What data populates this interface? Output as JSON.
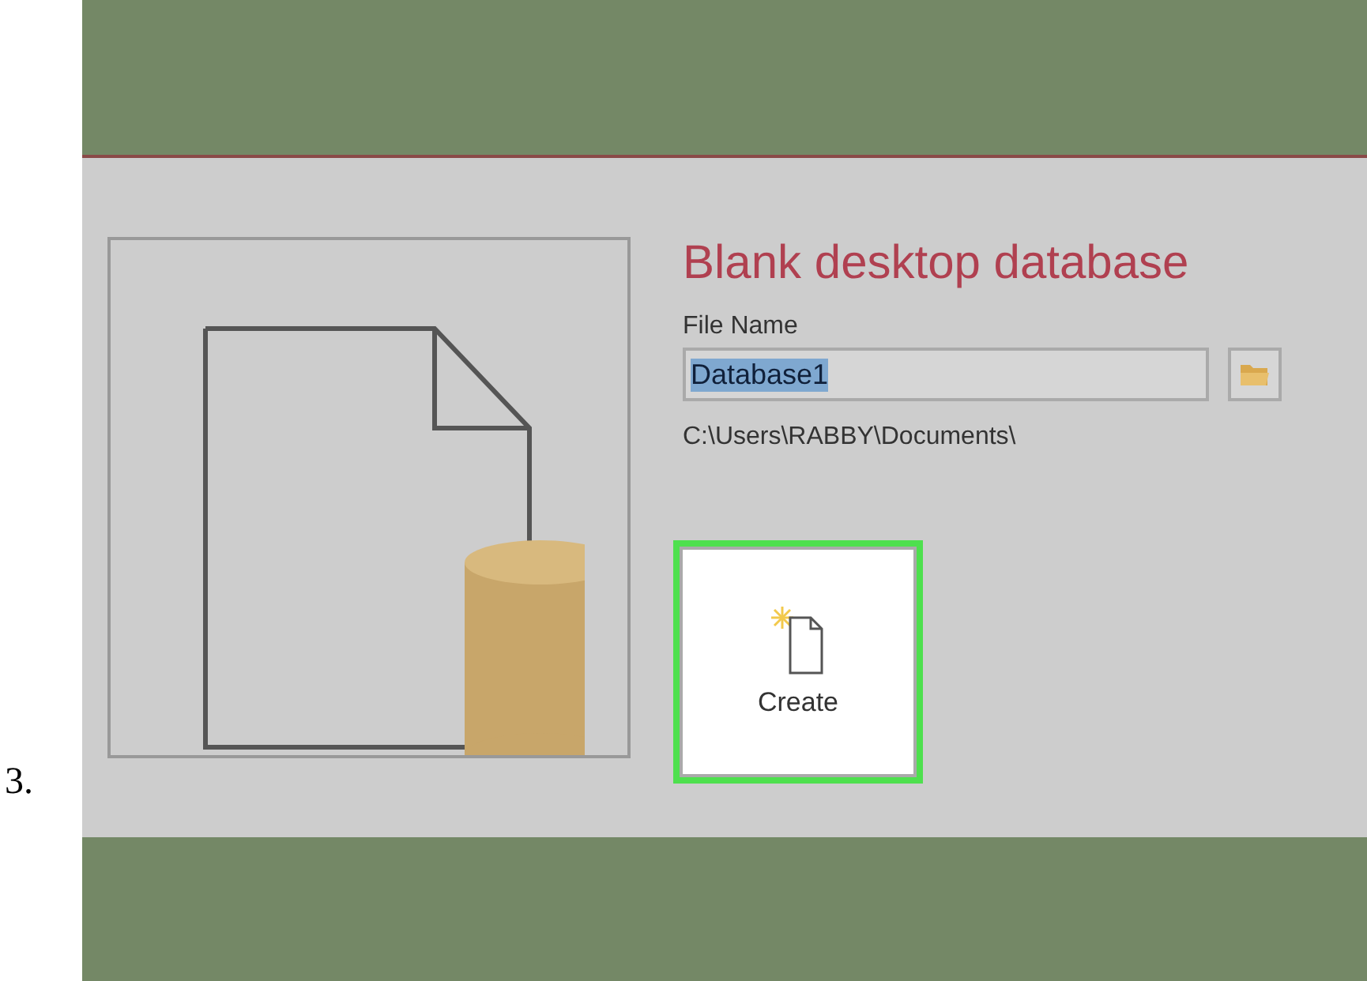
{
  "step_number": "3.",
  "panel": {
    "title": "Blank desktop database",
    "file_name": {
      "label": "File Name",
      "value": "Database1",
      "selected": true
    },
    "path": "C:\\Users\\RABBY\\Documents\\",
    "create_button": {
      "label": "Create",
      "focused": true
    }
  }
}
